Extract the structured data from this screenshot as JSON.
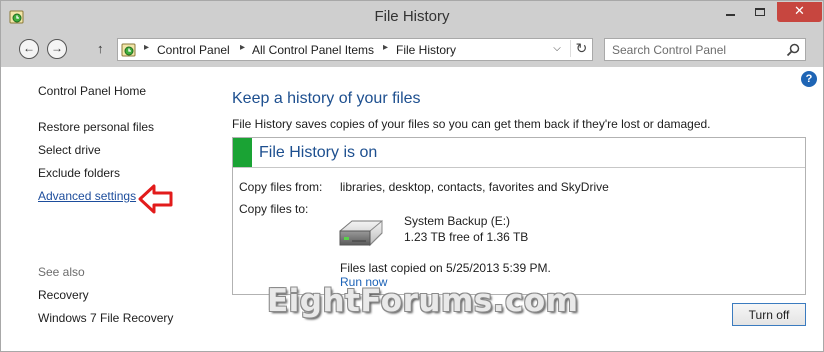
{
  "window": {
    "title": "File History",
    "close_glyph": "✕"
  },
  "nav": {
    "back_glyph": "←",
    "forward_glyph": "→",
    "up_glyph": "↑",
    "breadcrumbs": [
      "Control Panel",
      "All Control Panel Items",
      "File History"
    ],
    "separator_glyph": "▸",
    "dropdown_glyph": "⌵",
    "refresh_glyph": "↻",
    "search_placeholder": "Search Control Panel"
  },
  "help_glyph": "?",
  "sidebar": {
    "home": "Control Panel Home",
    "links": [
      "Restore personal files",
      "Select drive",
      "Exclude folders",
      "Advanced settings"
    ],
    "active_link_index": 3,
    "see_also_label": "See also",
    "see_also_links": [
      "Recovery",
      "Windows 7 File Recovery"
    ]
  },
  "main": {
    "title": "Keep a history of your files",
    "description": "File History saves copies of your files so you can get them back if they're lost or damaged.",
    "status": {
      "title": "File History is on",
      "copy_from_label": "Copy files from:",
      "copy_from_value": "libraries, desktop, contacts, favorites and SkyDrive",
      "copy_to_label": "Copy files to:",
      "drive_name": "System Backup (E:)",
      "drive_free": "1.23 TB free of 1.36 TB",
      "last_copied": "Files last copied on 5/25/2013 5:39 PM.",
      "run_now": "Run now"
    },
    "turn_off_label": "Turn off"
  },
  "watermark": "EightForums.com",
  "icons": {
    "app": "file-history-icon",
    "search": "search-icon",
    "help": "help-icon",
    "drive": "hard-drive-icon",
    "annotation": "red-arrow-icon"
  },
  "colors": {
    "status_green": "#1aa334",
    "heading_blue": "#1d4f8f",
    "link_blue": "#1d63b7",
    "close_red": "#c7463f",
    "annotation_red": "#e21b1b"
  }
}
